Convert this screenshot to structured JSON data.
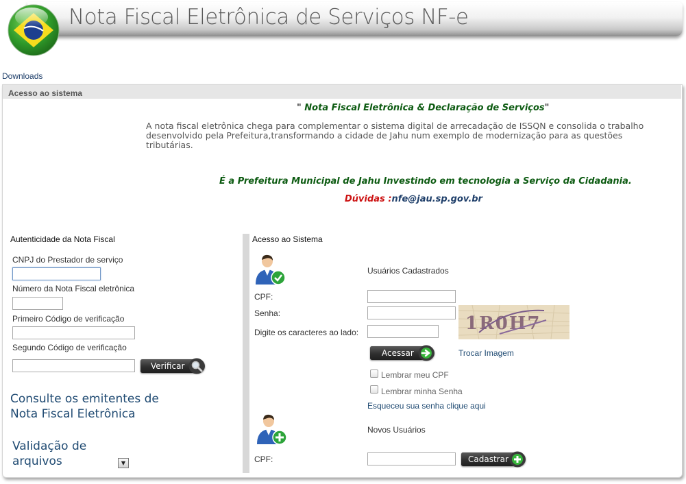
{
  "header": {
    "title": "Nota Fiscal Eletrônica de Serviços NF-e"
  },
  "nav": {
    "downloads": "Downloads"
  },
  "panel": {
    "title": "Acesso ao sistema"
  },
  "intro": {
    "title_open": "\"",
    "title": " Nota Fiscal Eletrônica & Declaração de Serviços",
    "title_close": "\"",
    "text": "A nota fiscal eletrônica chega para complementar o sistema digital de arrecadação de ISSQN e consolida o trabalho desenvolvido pela Prefeitura,transformando a cidade de Jahu num exemplo de modernização para as questões tributárias.",
    "slogan": "É a Prefeitura Municipal de Jahu Investindo em tecnologia a Serviço da Cidadania.",
    "doubts_label": "Dúvidas :",
    "doubts_email": "nfe@jau.sp.gov.br"
  },
  "authenticity": {
    "section_title": "Autenticidade da Nota Fiscal",
    "cnpj_label": "CNPJ do Prestador de serviço",
    "cnpj_value": "",
    "number_label": "Número da Nota Fiscal eletrônica",
    "number_value": "",
    "code1_label": "Primeiro Código de verificação",
    "code1_value": "",
    "code2_label": "Segundo Código de verificação",
    "code2_value": "",
    "verify_button": "Verificar"
  },
  "links": {
    "consult": "Consulte os emitentes de Nota Fiscal Eletrônica",
    "validation": "Validação de arquivos"
  },
  "access": {
    "section_title": "Acesso ao Sistema",
    "registered_title": "Usuários Cadastrados",
    "cpf_label": "CPF:",
    "cpf_value": "",
    "password_label": "Senha:",
    "password_value": "",
    "captcha_label": "Digite os caracteres ao lado:",
    "captcha_value": "",
    "captcha_text": "1R0H7",
    "login_button": "Acessar",
    "swap_image": "Trocar Imagem",
    "remember_cpf": "Lembrar meu CPF",
    "remember_password": "Lembrar minha Senha",
    "forgot": "Esqueceu sua senha clique aqui",
    "new_users_title": "Novos Usuários",
    "new_cpf_label": "CPF:",
    "new_cpf_value": "",
    "register_button": "Cadastrar"
  },
  "colors": {
    "accent_green": "#0d5b12",
    "link_blue": "#1f4a72",
    "alert_red": "#cc1111"
  },
  "icons": {
    "logo": "brazil-flag-icon",
    "verify": "magnifier-icon",
    "login": "arrow-right-icon",
    "register": "plus-icon",
    "registered_user": "user-check-icon",
    "new_user": "user-add-icon"
  }
}
